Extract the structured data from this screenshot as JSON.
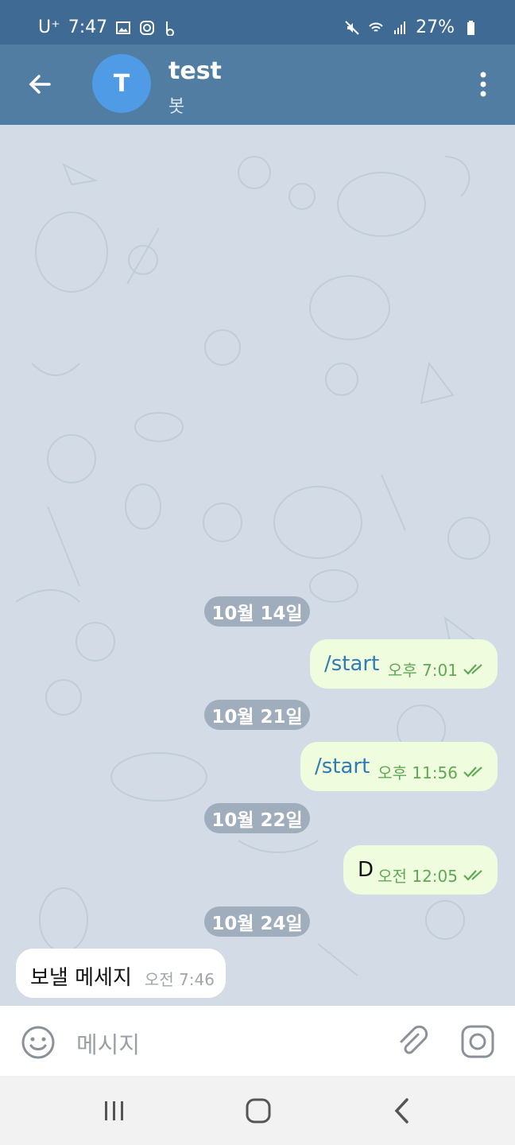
{
  "status": {
    "carrier": "U⁺",
    "time": "7:47",
    "battery": "27%"
  },
  "header": {
    "avatar_letter": "T",
    "title": "test",
    "subtitle": "봇"
  },
  "messages": [
    {
      "date": "10월 14일",
      "text": "/start",
      "time": "오후 7:01",
      "direction": "out"
    },
    {
      "date": "10월 21일",
      "text": "/start",
      "time": "오후 11:56",
      "direction": "out"
    },
    {
      "date": "10월 22일",
      "text": "D",
      "time": "오전 12:05",
      "direction": "out"
    },
    {
      "date": "10월 24일",
      "text": "보낼 메세지",
      "time": "오전 7:46",
      "direction": "in"
    }
  ],
  "composer": {
    "placeholder": "메시지"
  },
  "colors": {
    "appbar": "#527da3",
    "statusbar": "#3f6a93",
    "avatar": "#4f9be6",
    "outgoing_bubble": "#effdde",
    "command_link": "#2f7bb3",
    "check_marks": "#5fa854"
  }
}
